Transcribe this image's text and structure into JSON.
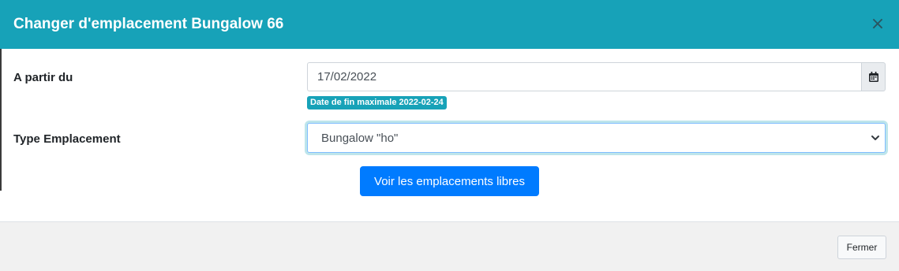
{
  "modal": {
    "title": "Changer d'emplacement Bungalow 66",
    "close_glyph": "×",
    "header_color": "#17a2b8"
  },
  "form": {
    "date_label": "A partir du",
    "date_value": "17/02/2022",
    "calendar_icon": "calendar-icon",
    "max_date_badge": "Date de fin maximale 2022-02-24",
    "type_label": "Type Emplacement",
    "type_selected": "Bungalow \"ho\"",
    "view_button": "Voir les emplacements libres"
  },
  "footer": {
    "close_button": "Fermer"
  }
}
